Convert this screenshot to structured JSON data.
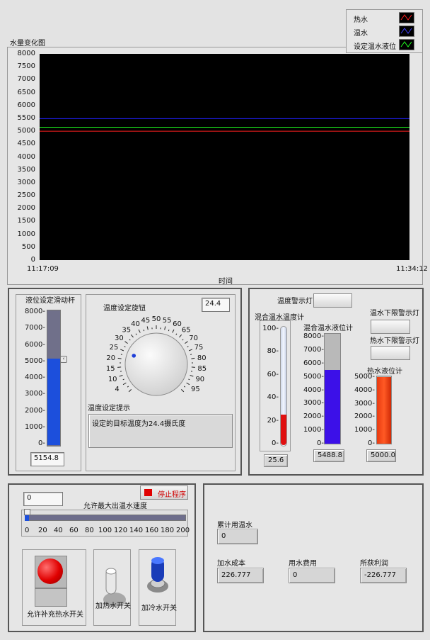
{
  "graph": {
    "title": "水量变化图",
    "xlabel": "时间",
    "x_start": "11:17:09",
    "x_end": "11:34:12",
    "yticks": [
      "8000",
      "7500",
      "7000",
      "6500",
      "6000",
      "5500",
      "5000",
      "4500",
      "4000",
      "3500",
      "3000",
      "2500",
      "2000",
      "1500",
      "1000",
      "500",
      "0"
    ],
    "legend": [
      {
        "name": "热水",
        "color": "#ff2020"
      },
      {
        "name": "温水",
        "color": "#2020ff"
      },
      {
        "name": "设定温水液位",
        "color": "#20ff20"
      }
    ]
  },
  "chart_data": {
    "type": "line",
    "title": "水量变化图",
    "xlabel": "时间",
    "ylabel": "",
    "x": [
      "11:17:09",
      "11:34:12"
    ],
    "ylim": [
      0,
      8000
    ],
    "series": [
      {
        "name": "热水",
        "color": "#ff2020",
        "values": [
          5000,
          5000
        ]
      },
      {
        "name": "温水",
        "color": "#2020ff",
        "values": [
          5488.8,
          5488.8
        ]
      },
      {
        "name": "设定温水液位",
        "color": "#20ff20",
        "values": [
          5154.8,
          5154.8
        ]
      }
    ],
    "grid": false,
    "legend_position": "top-right",
    "background": "#000000"
  },
  "level_slider": {
    "label": "液位设定滑动杆",
    "ticks": [
      "8000-",
      "7000-",
      "6000-",
      "5000-",
      "4000-",
      "3000-",
      "2000-",
      "1000-",
      "0-"
    ],
    "max": 8000,
    "value": 5154.8,
    "display": "5154.8"
  },
  "temp_knob": {
    "label": "温度设定旋钮",
    "display": "24.4",
    "value": 24.4,
    "ticks": [
      "0",
      "5",
      "10",
      "15",
      "20",
      "25",
      "30",
      "35",
      "40",
      "45",
      "50",
      "55",
      "60",
      "65",
      "70",
      "75",
      "80",
      "85",
      "90",
      "95",
      "100"
    ],
    "scale_labels": [
      "4",
      "10",
      "15",
      "20",
      "25",
      "30",
      "35",
      "40",
      "45",
      "50",
      "55",
      "60",
      "65",
      "70",
      "75",
      "80",
      "85",
      "90",
      "95"
    ],
    "hint_label": "温度设定提示",
    "hint_text": "设定的目标温度为24.4摄氏度"
  },
  "right_panel": {
    "temp_alarm_label": "温度警示灯",
    "mix_temp_label": "混合温水温度计",
    "mix_temp_ticks": [
      "100-",
      "80-",
      "60-",
      "40-",
      "20-",
      "0-"
    ],
    "mix_temp_value": 25.6,
    "mix_temp_display": "25.6",
    "mix_level_label": "混合温水液位计",
    "mix_level_ticks": [
      "8000-",
      "7000-",
      "6000-",
      "5000-",
      "4000-",
      "3000-",
      "2000-",
      "1000-",
      "0-"
    ],
    "mix_level_value": 5488.8,
    "mix_level_display": "5488.8",
    "warm_low_label": "温水下限警示灯",
    "hot_low_label": "热水下限警示灯",
    "hot_level_label": "热水液位计",
    "hot_level_ticks": [
      "5000-",
      "4000-",
      "3000-",
      "2000-",
      "1000-",
      "0-"
    ],
    "hot_level_value": 5000,
    "hot_level_display": "5000.0",
    "hot_level_max": 5000,
    "mix_level_max": 8000,
    "mix_temp_max": 100
  },
  "control_panel": {
    "speed_input": "0",
    "stop_label": "停止程序",
    "speed_label": "允许最大出温水速度",
    "speed_ticks": [
      "0",
      "20",
      "40",
      "60",
      "80",
      "100",
      "120",
      "140",
      "160",
      "180",
      "200"
    ],
    "speed_value": 0,
    "hot_switch_label": "允许补充热水开关",
    "heat_switch_label": "加热水开关",
    "cold_switch_label": "加冷水开关"
  },
  "cost_panel": {
    "total_warm_label": "累计用温水",
    "total_warm_value": "0",
    "add_cost_label": "加水成本",
    "add_cost_value": "226.777",
    "water_fee_label": "用水费用",
    "water_fee_value": "0",
    "profit_label": "所获利润",
    "profit_value": "-226.777"
  }
}
